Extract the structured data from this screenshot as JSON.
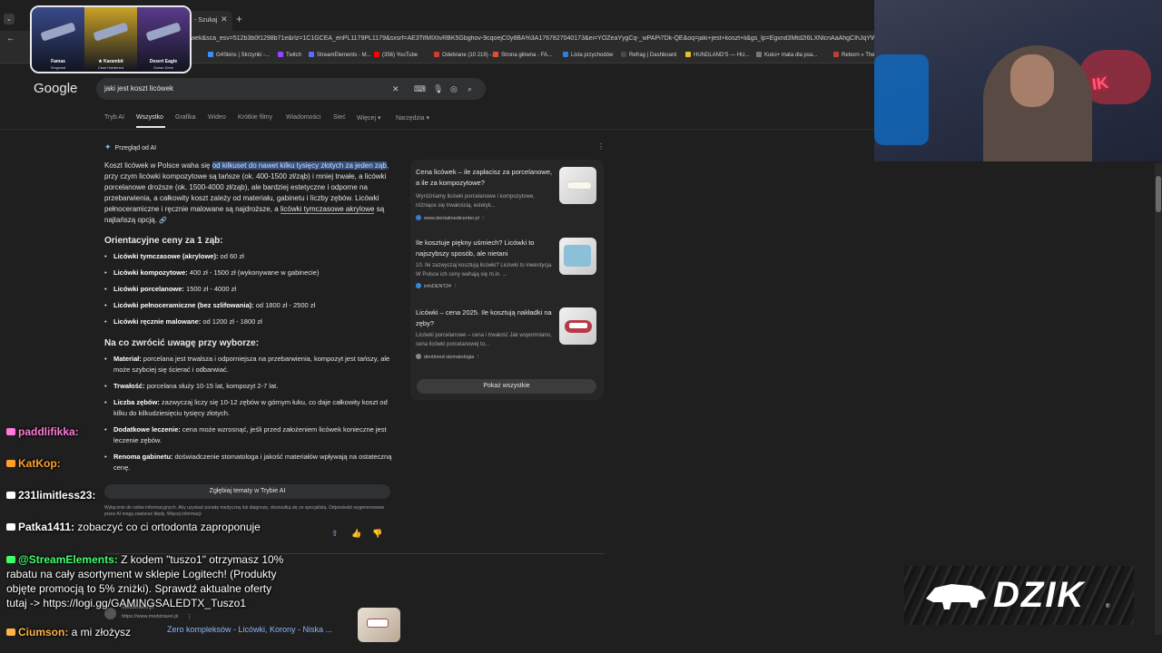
{
  "browser": {
    "tab_title": "- Szukaj",
    "url": "wek&sca_esv=512b3b0f1298b71e&rlz=1C1GCEA_enPL1179PL1179&sxsrf=AE3TifMIXtvRBK5Gbghov-9cqoejC0y8BA%3A1767827040173&ei=YOZeaYygCq-_wPAPi7Dk-QE&oq=jaki+jest+koszt+li&gs_lp=Egxnd3Mtd2l6LXNlcnAaAhgCIhJqYWtpIGplc3Q",
    "bookmarks": [
      {
        "label": "G4Skins | Skrzynki -...",
        "color": "#3e8ef7"
      },
      {
        "label": "Twitch",
        "color": "#9146ff"
      },
      {
        "label": "StreamElements - M...",
        "color": "#5b6cff"
      },
      {
        "label": "(356) YouTube",
        "color": "#ff0000"
      },
      {
        "label": "Odebrane (10 219) -...",
        "color": "#d33b2c"
      },
      {
        "label": "Strona główna - FA...",
        "color": "#e34d2c"
      },
      {
        "label": "Lista przychodów",
        "color": "#2f7de1"
      },
      {
        "label": "Refrag | Dashboard",
        "color": "#4a4a4a"
      },
      {
        "label": "HUNDLAND'S — HU...",
        "color": "#e8c22c"
      },
      {
        "label": "Kuko+ mata dla psa...",
        "color": "#777777"
      },
      {
        "label": "Reborn » The Ho...",
        "color": "#c23b3b"
      }
    ]
  },
  "google": {
    "logo": "Google",
    "query": "jaki jest koszt licówek",
    "tabs": [
      "Tryb AI",
      "Wszystko",
      "Grafika",
      "Wideo",
      "Krótkie filmy",
      "Wiadomości",
      "Sieć",
      "Więcej ▾",
      "Narzędzia ▾"
    ],
    "active_tab": "Wszystko"
  },
  "ai_overview": {
    "heading": "Przegląd od AI",
    "intro_pre": "Koszt licówek w Polsce waha się ",
    "intro_highlight": "od kilkuset do nawet kilku tysięcy złotych za jeden ząb",
    "intro_post": ", przy czym licówki kompozytowe są tańsze (ok. 400-1500 zł/ząb) i mniej trwałe, a licówki porcelanowe droższe (ok. 1500-4000 zł/ząb), ale bardziej estetyczne i odporne na przebarwienia, a całkowity koszt zależy od materiału, gabinetu i liczby zębów. Licówki pełnoceramiczne i ręcznie malowane są najdroższe, a ",
    "intro_link": "licówki tymczasowe akrylowe",
    "intro_end": " są najtańszą opcją.",
    "prices_heading": "Orientacyjne ceny za 1 ząb:",
    "prices": [
      {
        "name": "Licówki tymczasowe (akrylowe):",
        "value": " od 60 zł"
      },
      {
        "name": "Licówki kompozytowe:",
        "value": " 400 zł - 1500 zł (wykonywane w gabinecie)"
      },
      {
        "name": "Licówki porcelanowe:",
        "value": " 1500 zł - 4000 zł"
      },
      {
        "name": "Licówki pełnoceramiczne (bez szlifowania):",
        "value": " od 1800 zł - 2500 zł"
      },
      {
        "name": "Licówki ręcznie malowane:",
        "value": " od 1200 zł - 1800 zł"
      }
    ],
    "choose_heading": "Na co zwrócić uwagę przy wyborze:",
    "choose": [
      {
        "name": "Materiał:",
        "value": " porcelana jest trwalsza i odporniejsza na przebarwienia, kompozyt jest tańszy, ale może szybciej się ścierać i odbarwiać."
      },
      {
        "name": "Trwałość:",
        "value": " porcelana służy 10-15 lat, kompozyt 2-7 lat."
      },
      {
        "name": "Liczba zębów:",
        "value": " zazwyczaj liczy się 10-12 zębów w górnym łuku, co daje całkowity koszt od kilku do kilkudziesięciu tysięcy złotych."
      },
      {
        "name": "Dodatkowe leczenie:",
        "value": " cena może wzrosnąć, jeśli przed założeniem licówek konieczne jest leczenie zębów."
      },
      {
        "name": "Renoma gabinetu:",
        "value": " doświadczenie stomatologa i jakość materiałów wpływają na ostateczną cenę."
      }
    ],
    "deep_button": "Zgłębiaj tematy w Trybie AI",
    "disclaimer": "Wyłącznie do celów informacyjnych. Aby uzyskać poradę medyczną lub diagnozę, skonsultuj się ze specjalistą. Odpowiedzi wygenerowane przez AI mogą zawierać błędy. Więcej informacji"
  },
  "sources": [
    {
      "title": "Cena licówek – ile zapłacisz za porcelanowe, a ile za kompozytowe?",
      "snippet": "Wyróżniamy licówki porcelanowe i kompozytowe, różniące się trwałością, estetyk...",
      "site": "www.dentalmedicenter.pl",
      "fav_color": "#3a7bd5"
    },
    {
      "title": "Ile kosztuje piękny uśmiech? Licówki to najszybszy sposób, ale nietani",
      "snippet": "10. Ile zazwyczaj kosztują licówki? Licówki to inwestycja. W Polsce ich ceny wahają się m.in. ...",
      "site": "infoDENT24",
      "fav_color": "#2c8be0"
    },
    {
      "title": "Licówki – cena 2025. Ile kosztują nakładki na zęby?",
      "snippet": "Licówki porcelanowe – cena i trwałość Jak wspomniano, cena licówki porcelanowej to...",
      "site": "dentimed stomatologia",
      "fav_color": "#888888"
    }
  ],
  "show_all": "Pokaż wszystkie",
  "next_result": {
    "site": "medstravel.pl",
    "url": "https://www.medstravel.pl",
    "title": "Zero kompleksów - Licówki, Korony - Niska ..."
  },
  "overlay": {
    "skins": [
      {
        "name": "Famas",
        "sub": "Sergeant",
        "color": "#3a4a8a"
      },
      {
        "name": "★ Karambit",
        "sub": "Case Hardened",
        "color": "#c9a227"
      },
      {
        "name": "Desert Eagle",
        "sub": "Ocean Drive",
        "color": "#5a3a8a"
      }
    ],
    "chat": [
      {
        "user": "paddlifikka:",
        "message": "",
        "color": "#ff7ad9"
      },
      {
        "user": "KatKop:",
        "message": "",
        "color": "#ff9f2e"
      },
      {
        "user": "231limitless23:",
        "message": "",
        "color": "#ffffff"
      },
      {
        "user": "Patka1411:",
        "message": " zobaczyć co ci ortodonta zaproponuje",
        "color": "#ffffff"
      },
      {
        "user": "@StreamElements:",
        "message": " Z kodem \"tuszo1\" otrzymasz 10%",
        "color": "#3dff6b"
      },
      {
        "user": "",
        "message": "rabatu na cały asortyment w sklepie Logitech! (Produkty",
        "color": "#ffffff"
      },
      {
        "user": "",
        "message": "objęte promocją to 5% zniżki). Sprawdź aktualne oferty",
        "color": "#ffffff"
      },
      {
        "user": "",
        "message": "tutaj -> https://logi.gg/GAMINGSALEDTX_Tuszo1",
        "color": "#ffffff"
      },
      {
        "user": "Ciumson:",
        "message": " a mi złożysz",
        "color": "#ffb347"
      }
    ],
    "logo_text": "DZIK",
    "logo_reg": "®"
  }
}
